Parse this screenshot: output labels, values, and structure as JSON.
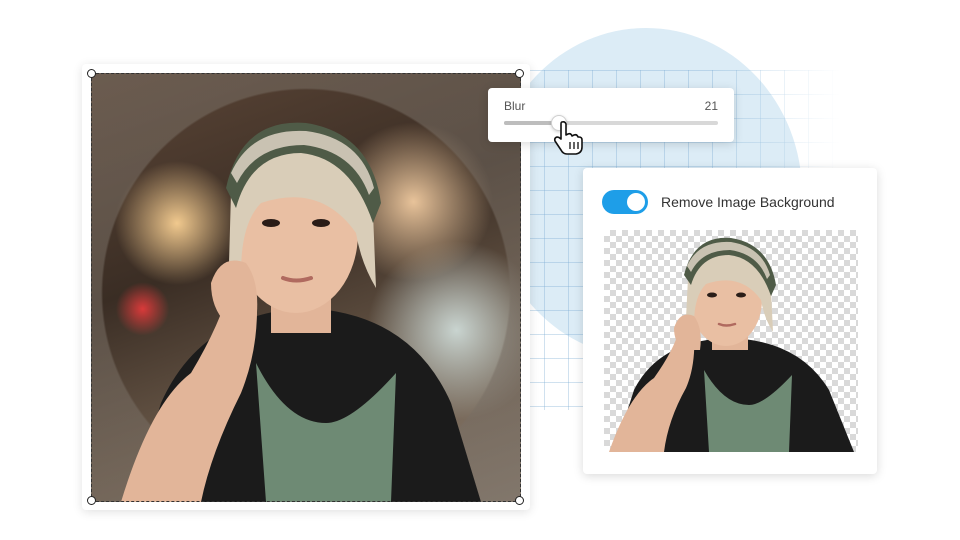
{
  "blur_panel": {
    "label": "Blur",
    "value": "21",
    "slider_fraction": 0.25
  },
  "remove_bg_panel": {
    "label": "Remove Image Background",
    "toggle_on": true
  },
  "colors": {
    "accent": "#1e9ee8",
    "circle_bg": "#dcecf6"
  },
  "icons": {
    "cursor": "hand-pointer-icon"
  }
}
